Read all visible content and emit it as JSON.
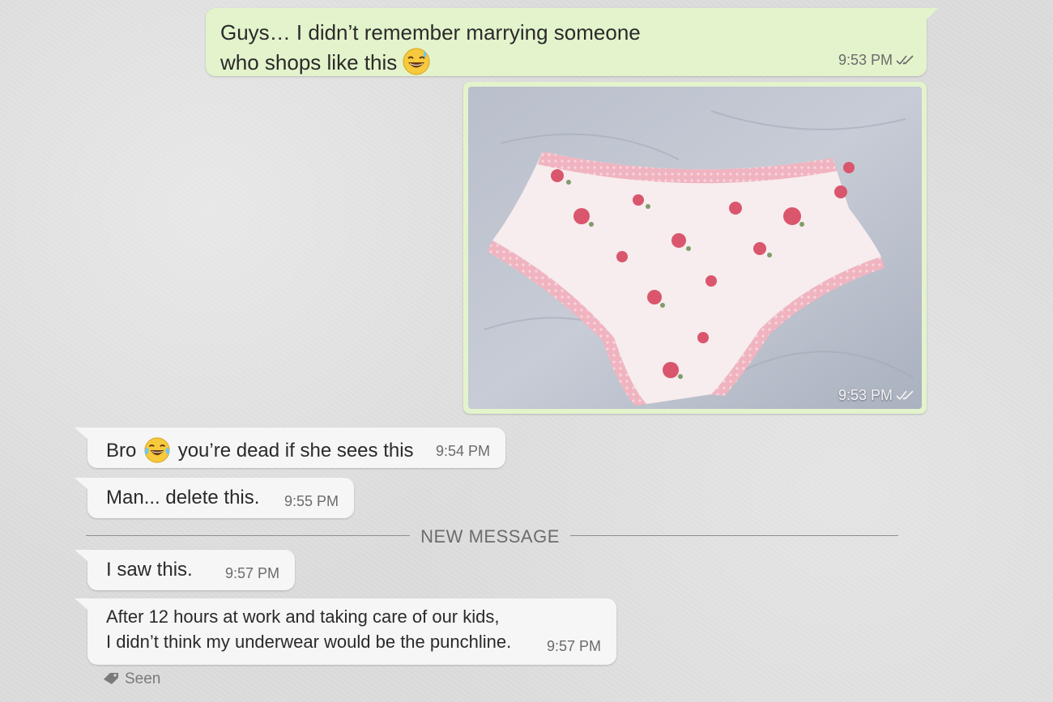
{
  "messages": [
    {
      "direction": "outgoing",
      "text_line1": "Guys… I didn’t remember marrying someone",
      "text_line2": "who shops like this",
      "emoji": "grinning-sweat-emoji",
      "time": "9:53 PM",
      "status": "read"
    },
    {
      "direction": "outgoing",
      "type": "image",
      "image_desc_icon": "floral-underwear-photo",
      "time": "9:53 PM",
      "status": "read"
    },
    {
      "direction": "incoming",
      "text_before": "Bro",
      "emoji": "tears-of-joy-emoji",
      "text_after": "you’re dead if she sees this",
      "time": "9:54 PM"
    },
    {
      "direction": "incoming",
      "text": "Man... delete this.",
      "time": "9:55 PM"
    },
    {
      "direction": "incoming",
      "text": "I saw this.",
      "time": "9:57 PM"
    },
    {
      "direction": "incoming",
      "text_line1": "After 12 hours at work and taking care of our kids,",
      "text_line2": "I didn’t think my underwear would be the punchline.",
      "time": "9:57 PM"
    }
  ],
  "divider": {
    "label": "NEW MESSAGE"
  },
  "seen": {
    "label": "Seen",
    "icon": "tag-icon"
  },
  "colors": {
    "outgoing": "#e3f3cc",
    "incoming": "#f6f6f6",
    "background": "#dcdcdc"
  }
}
